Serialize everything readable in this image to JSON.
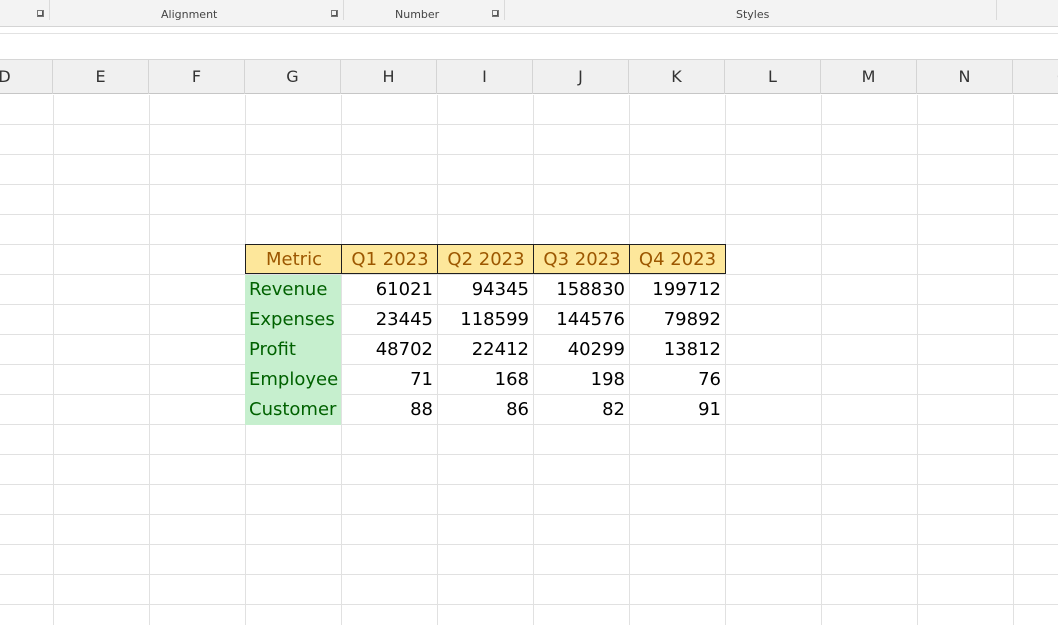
{
  "ribbon": {
    "groups": [
      {
        "label": "Alignment"
      },
      {
        "label": "Number"
      },
      {
        "label": "Styles"
      }
    ]
  },
  "columns": [
    "D",
    "E",
    "F",
    "G",
    "H",
    "I",
    "J",
    "K",
    "L",
    "M",
    "N",
    "O"
  ],
  "table": {
    "headers": [
      "Metric",
      "Q1 2023",
      "Q2 2023",
      "Q3 2023",
      "Q4 2023"
    ],
    "rows": [
      {
        "label": "Revenue",
        "values": [
          "61021",
          "94345",
          "158830",
          "199712"
        ]
      },
      {
        "label": "Expenses",
        "values": [
          "23445",
          "118599",
          "144576",
          "79892"
        ]
      },
      {
        "label": "Profit",
        "values": [
          "48702",
          "22412",
          "40299",
          "13812"
        ]
      },
      {
        "label": "Employee",
        "values": [
          "71",
          "168",
          "198",
          "76"
        ]
      },
      {
        "label": "Customer",
        "values": [
          "88",
          "86",
          "82",
          "91"
        ]
      }
    ]
  },
  "colors": {
    "header_fill": "#fde79b",
    "header_text": "#9c5700",
    "label_fill": "#c6efce",
    "label_text": "#006100",
    "gridline": "#e1e1e1"
  }
}
